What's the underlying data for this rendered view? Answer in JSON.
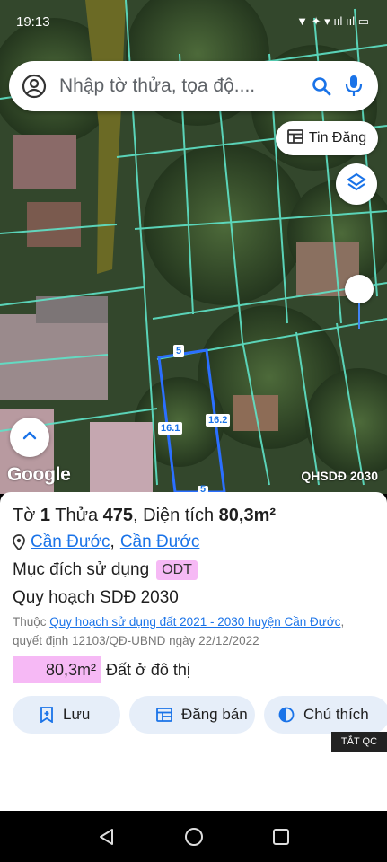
{
  "status": {
    "time": "19:13",
    "icons_text": "▼ ✦ ▾ ııl ııl ▭"
  },
  "search": {
    "placeholder": "Nhập tờ thửa, tọa độ...."
  },
  "map": {
    "tin_dang_label": "Tin Đăng",
    "google_label": "Google",
    "layer_label": "QHSDĐ 2030",
    "parcel_edges": {
      "top": "5",
      "left": "16.1",
      "right": "16.2",
      "bottom": "5"
    }
  },
  "parcel": {
    "to_label": "Tờ",
    "to_value": "1",
    "thua_label": "Thửa",
    "thua_value": "475",
    "area_label": "Diện tích",
    "area_value": "80,3m²",
    "district": "Cần Đước",
    "separator": ",",
    "commune": "Cần Đước",
    "purpose_label": "Mục đích sử dụng",
    "purpose_code": "ODT",
    "plan_title": "Quy hoạch SDĐ 2030",
    "note_prefix": "Thuộc",
    "note_link": "Quy hoạch sử dụng đất 2021 - 2030 huyện Cần Đước",
    "note_suffix": ", quyết định 12103/QĐ-UBND ngày 22/12/2022",
    "area_badge": "80,3m²",
    "area_type": "Đất ở đô thị"
  },
  "actions": {
    "save": "Lưu",
    "sell": "Đăng bán",
    "legend": "Chú thích"
  },
  "ad_label": "TẮT QC",
  "colors": {
    "accent": "#1a73e8",
    "badge": "#f6b9f5",
    "button_bg": "#e6eef9",
    "boundary": "#5fe3c8"
  }
}
